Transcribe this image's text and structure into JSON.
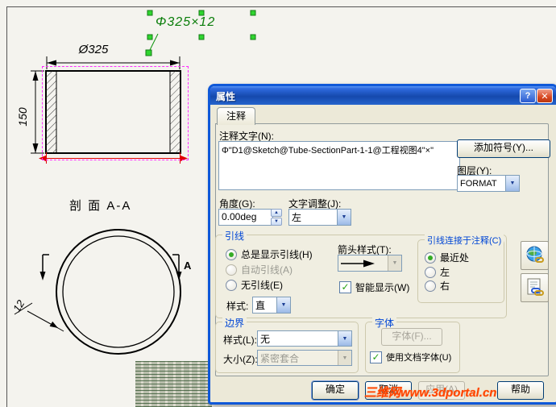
{
  "icons": {
    "dropdown": "▼",
    "spin_up": "▲",
    "spin_down": "▼",
    "check": "✓",
    "help_glyph": "?",
    "close_glyph": "✕"
  },
  "drawing": {
    "note_dim": "Φ325×12",
    "dia_dim": "Ø325",
    "height_dim": "150",
    "thickness_dim": "12",
    "section_title": "剖 面  A-A",
    "section_mark": "A"
  },
  "watermark": "三维网www.3dportal.cn",
  "dialog": {
    "title": "属性",
    "tab_label": "注释",
    "note_label": "注释文字(N):",
    "note_value": "Φ\"D1@Sketch@Tube-SectionPart-1-1@工程视图4\"×\"",
    "add_symbol_button": "添加符号(Y)...",
    "layer_label": "图层(Y):",
    "layer_value": "FORMAT",
    "angle_label": "角度(G):",
    "angle_value": "0.00deg",
    "justify_label": "文字调整(J):",
    "justify_value": "左",
    "leader": {
      "group_label": "引线",
      "always": "总是显示引线(H)",
      "auto": "自动引线(A)",
      "none": "无引线(E)",
      "arrow_label": "箭头样式(T):",
      "smart": "智能显示(W)",
      "attach_group": "引线连接于注释(C)",
      "nearest": "最近处",
      "left": "左",
      "right": "右",
      "style_label": "样式:",
      "style_value": "直"
    },
    "border": {
      "group_label": "边界",
      "style_label": "样式(L):",
      "style_value": "无",
      "size_label": "大小(Z):",
      "size_value": "紧密套合"
    },
    "font": {
      "group_label": "字体",
      "font_button": "字体(F)...",
      "use_doc_font": "使用文档字体(U)"
    },
    "buttons": {
      "ok": "确定",
      "cancel": "取消",
      "apply": "应用(A)",
      "help": "帮助"
    }
  }
}
